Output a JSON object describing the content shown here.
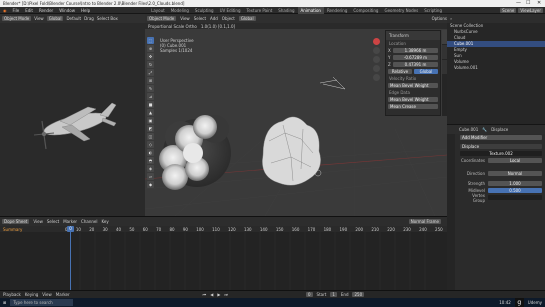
{
  "window": {
    "title": "Blender* [D:\\Pixel Fold\\Blender Course\\Intro to Blender 2.0\\Blender Files\\2.0_Clouds.blend]",
    "min": "—",
    "max": "☐",
    "close": "✕"
  },
  "menu": [
    "File",
    "Edit",
    "Render",
    "Window",
    "Help"
  ],
  "workspaces": [
    "Layout",
    "Modeling",
    "Sculpting",
    "UV Editing",
    "Texture Paint",
    "Shading",
    "Animation",
    "Rendering",
    "Compositing",
    "Geometry Nodes",
    "Scripting"
  ],
  "active_workspace": "Animation",
  "scene_field": "Scene",
  "viewlayer_field": "ViewLayer",
  "left_toolbar": {
    "mode": "Object Mode",
    "view": "View",
    "orientation": "Global",
    "default": "Default",
    "drag": "Drag",
    "select_box": "Select Box"
  },
  "main_header": {
    "mode": "Object Mode",
    "view": "View",
    "select": "Select",
    "add": "Add",
    "object": "Object",
    "orientation": "Global",
    "options": "Options"
  },
  "main_header_extra": {
    "view_type": "Proportional Scale Ortho",
    "zoom": "1.0(1.0) [0.1,1.0]"
  },
  "viewport_info": {
    "line1": "User Perspective",
    "line2": "(0) Cube.001",
    "line3": "Samples 1/1024"
  },
  "npanel": {
    "tab": "Transform",
    "tabs": [
      "Item",
      "Tool",
      "View"
    ],
    "location_label": "Location",
    "x": "X",
    "x_val": "1.38966 m",
    "y": "Y",
    "y_val": "-0.67289 m",
    "z": "Z",
    "z_val": "0.47391 m",
    "relative_label": "Relative",
    "relative_val": "Global",
    "velocity_label": "Velocity Ratio",
    "mean_bevel": "Mean Bevel Weight",
    "mean_bevel_val": "0.000",
    "edge_data": "Edge Data",
    "mean_crease": "Mean Bevel Weight",
    "mean_crease_val": "0.000",
    "mean_crease2": "Mean Crease",
    "mean_crease2_val": "0.000"
  },
  "outliner": {
    "header": "Scene Collection",
    "items": [
      {
        "name": "Scene Collection",
        "sel": false
      },
      {
        "name": "NurbsCurve",
        "sel": false
      },
      {
        "name": "Cloud",
        "sel": false
      },
      {
        "name": "Cube.001",
        "sel": true
      },
      {
        "name": "Empty",
        "sel": false
      },
      {
        "name": "Sun",
        "sel": false
      },
      {
        "name": "Volume",
        "sel": false
      },
      {
        "name": "Volume.001",
        "sel": false
      }
    ]
  },
  "properties": {
    "object_name": "Cube.001",
    "modifier_name": "Displace",
    "add_modifier": "Add Modifier",
    "displace_label": "Displace",
    "texture_label": "Texture",
    "texture_val": "Texture.002",
    "coords_label": "Coordinates",
    "coords_val": "Local",
    "direction_label": "Direction",
    "direction_val": "Normal",
    "strength_label": "Strength",
    "strength_val": "1.000",
    "midlevel_label": "Midlevel",
    "midlevel_val": "0.500",
    "vgroup_label": "Vertex Group"
  },
  "timeline": {
    "editor": "Dope Sheet",
    "menus": [
      "View",
      "Select",
      "Marker",
      "Channel",
      "Key"
    ],
    "summary": "Summary",
    "mode": "Normal Frame",
    "ticks": [
      "0",
      "10",
      "20",
      "30",
      "40",
      "50",
      "60",
      "70",
      "80",
      "90",
      "100",
      "110",
      "120",
      "130",
      "140",
      "150",
      "160",
      "170",
      "180",
      "190",
      "200",
      "210",
      "220",
      "230",
      "240",
      "250"
    ],
    "current_frame": "0"
  },
  "statusbar": {
    "playback": "Playback",
    "keying": "Keying",
    "view": "View",
    "marker": "Marker",
    "frame": "0",
    "start": "Start",
    "start_val": "1",
    "end": "End",
    "end_val": "250",
    "version": "Verts 6 | Faces 1 | Objects 1/7 | 3.3.0",
    "left": "Select",
    "middle": "Box Select",
    "right": "Rotate View",
    "object": "Object Context Menu"
  },
  "taskbar": {
    "search": "Type here to search",
    "time": "10:42",
    "badge": "g",
    "badge_label": "Udemy"
  },
  "colors": {
    "accent": "#4772b3",
    "active": "#ff8c1a"
  }
}
